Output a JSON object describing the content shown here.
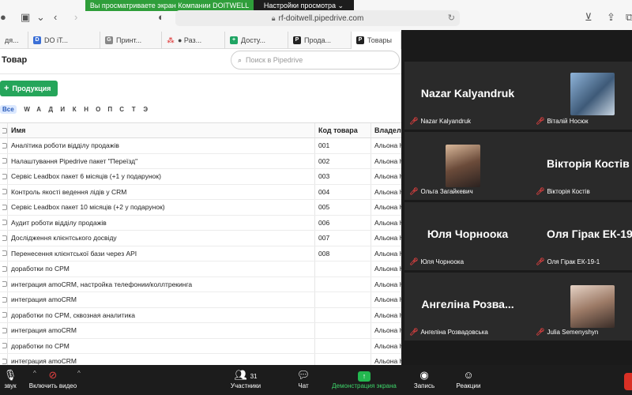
{
  "browser": {
    "share_message": "Вы просматриваете экран Компании DOITWELL",
    "view_settings": "Настройки просмотра ⌄",
    "url": "rf-doitwell.pipedrive.com",
    "tabs": [
      {
        "label": "дя..."
      },
      {
        "label": "DO iT..."
      },
      {
        "label": "Принт..."
      },
      {
        "label": "● Раз..."
      },
      {
        "label": "Досту..."
      },
      {
        "label": "Прода..."
      },
      {
        "label": "Товары"
      }
    ]
  },
  "page": {
    "title": "Товар",
    "search_placeholder": "Поиск в Pipedrive",
    "add_button": "Продукция",
    "alphabet": [
      "Все",
      "W",
      "А",
      "Д",
      "И",
      "К",
      "Н",
      "О",
      "П",
      "С",
      "Т",
      "Э"
    ],
    "columns": {
      "name": "Имя",
      "code": "Код товара",
      "owner": "Владелец"
    },
    "rows": [
      {
        "name": "Аналітика роботи відділу продажів",
        "code": "001",
        "owner": "Альона Н"
      },
      {
        "name": "Налаштування Pipedrive пакет \"Переїзд\"",
        "code": "002",
        "owner": "Альона Н"
      },
      {
        "name": "Сервіс Leadbox пакет 6 місяців (+1 у подарунок)",
        "code": "003",
        "owner": "Альона Н"
      },
      {
        "name": "Контроль якості ведення лідів у CRM",
        "code": "004",
        "owner": "Альона Н"
      },
      {
        "name": "Сервіс Leadbox пакет 10 місяців (+2 у подарунок)",
        "code": "005",
        "owner": "Альона Н"
      },
      {
        "name": "Аудит роботи відділу продажів",
        "code": "006",
        "owner": "Альона Н"
      },
      {
        "name": "Дослідження клієнтського досвіду",
        "code": "007",
        "owner": "Альона Н"
      },
      {
        "name": "Перенесення клієнтської бази через API",
        "code": "008",
        "owner": "Альона Н"
      },
      {
        "name": "доработки по CPM",
        "code": "",
        "owner": "Альона Н"
      },
      {
        "name": "интеграция amoCRM, настройка телефонии/коллтрекинга",
        "code": "",
        "owner": "Альона Н"
      },
      {
        "name": "интеграция amoCRM",
        "code": "",
        "owner": "Альона Н"
      },
      {
        "name": "доработки по CPM, сквозная аналитика",
        "code": "",
        "owner": "Альона Н"
      },
      {
        "name": "интеграция amoCRM",
        "code": "",
        "owner": "Альона Н"
      },
      {
        "name": "доработки по CPM",
        "code": "",
        "owner": "Альона Н"
      },
      {
        "name": "интеграция amoCRM",
        "code": "",
        "owner": "Альона Н"
      }
    ]
  },
  "zoom": {
    "participants": [
      {
        "big": "Nazar Kalyandruk",
        "label": "Nazar Kalyandruk",
        "video": false
      },
      {
        "big": "",
        "label": "Віталій Носюк",
        "video": true
      },
      {
        "big": "",
        "label": "Ольга Загайкевич",
        "video": true
      },
      {
        "big": "Вікторія Костів",
        "label": "Вікторія Костів",
        "video": false
      },
      {
        "big": "Юля Чорноока",
        "label": "Юля Чорноока",
        "video": false
      },
      {
        "big": "Оля Гірак ЕК-19-1",
        "label": "Оля Гірак ЕК-19-1",
        "video": false
      },
      {
        "big": "Ангеліна Розва...",
        "label": "Ангеліна Розвадовська",
        "video": false
      },
      {
        "big": "",
        "label": "Julia Semenyshyn",
        "video": true
      }
    ],
    "toolbar": {
      "sound": "звук",
      "video": "Включить видео",
      "participants": "Участники",
      "participants_count": "31",
      "chat": "Чат",
      "share": "Демонстрация экрана",
      "record": "Запись",
      "reactions": "Реакции"
    }
  }
}
